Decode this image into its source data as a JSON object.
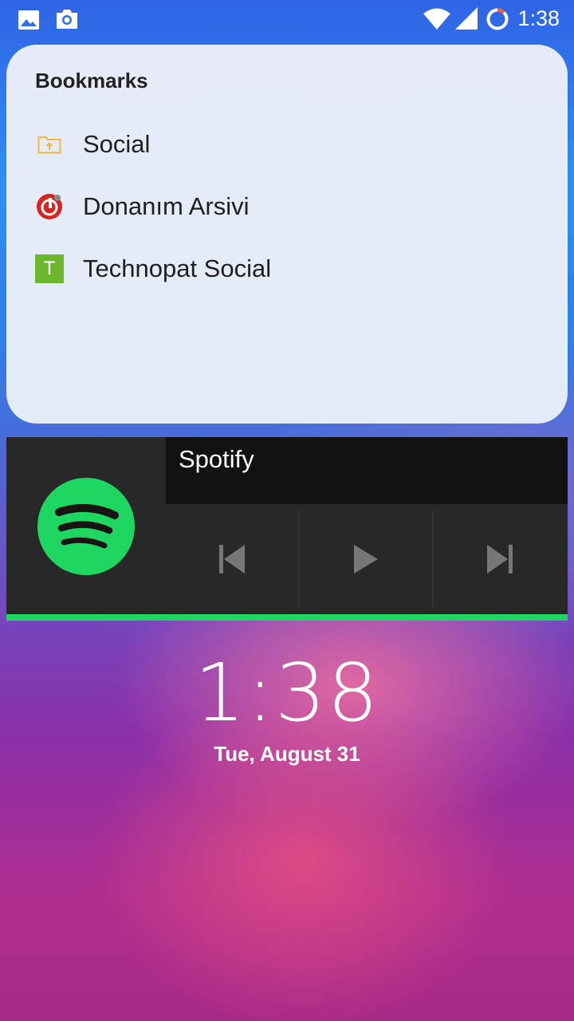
{
  "status_bar": {
    "time": "1:38",
    "icons": [
      "image-icon",
      "camera-icon",
      "wifi-icon",
      "signal-icon",
      "battery-icon"
    ]
  },
  "bookmarks": {
    "title": "Bookmarks",
    "items": [
      {
        "label": "Social",
        "icon": "folder-icon"
      },
      {
        "label": "Donanım Arsivi",
        "icon": "donanim-arsivi-icon"
      },
      {
        "label": "Technopat Social",
        "icon": "technopat-icon",
        "icon_letter": "T"
      }
    ]
  },
  "spotify": {
    "title": "Spotify",
    "controls": [
      "previous",
      "play",
      "next"
    ],
    "accent": "#1ed760"
  },
  "lockscreen": {
    "time": "1:38",
    "date": "Tue, August 31"
  }
}
